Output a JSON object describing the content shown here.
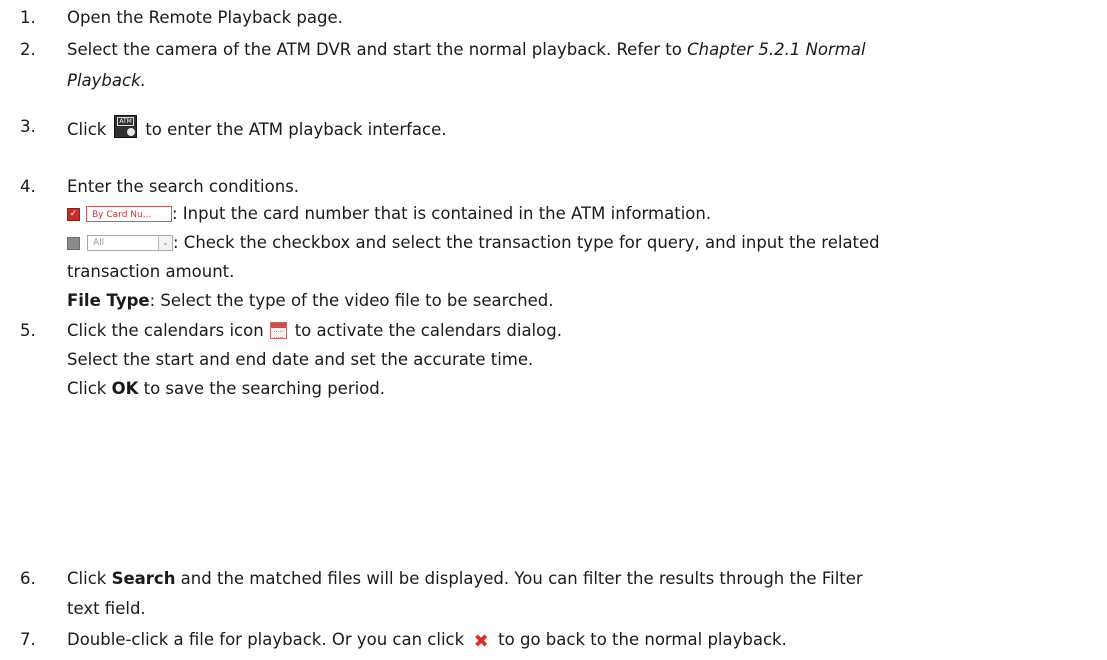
{
  "steps": [
    {
      "num": "1.",
      "text": "Open the Remote Playback page."
    },
    {
      "num": "2.",
      "line1": "Select the camera of the ATM DVR and start the normal playback. Refer to ",
      "ref1": "Chapter 5.2.1 Normal",
      "ref2": "Playback."
    },
    {
      "num": "3.",
      "pre": "Click",
      "post": "to enter the ATM playback interface."
    },
    {
      "num": "4.",
      "text": "Enter the search conditions.",
      "card_placeholder": "By Card Nu...",
      "card_desc": ": Input the card number that is contained in the ATM information.",
      "type_select_value": "All",
      "type_desc1": ": Check the checkbox and select the transaction type for query, and input the related",
      "type_desc2": "transaction amount.",
      "filetype_label": "File Type",
      "filetype_desc": ": Select the type of the video file to be searched."
    },
    {
      "num": "5.",
      "pre": "Click the calendars icon",
      "post": "to activate the calendars dialog.",
      "line2": "Select the start and end date and set the accurate time.",
      "line3_pre": "Click ",
      "line3_bold": "OK",
      "line3_post": " to save the searching period."
    },
    {
      "num": "6.",
      "pre": "Click ",
      "bold": "Search",
      "post": " and the matched files will be displayed. You can filter the results through the Filter",
      "line2": "text field."
    },
    {
      "num": "7.",
      "pre": "Double-click a file for playback. Or you can click",
      "post": "to go back to the normal playback."
    }
  ],
  "icons": [
    "atm-playback-icon",
    "checkbox-checked-icon",
    "checkbox-unchecked-icon",
    "dropdown-arrow-icon",
    "calendar-icon",
    "close-icon"
  ],
  "colors": {
    "text": "#1a1a1a",
    "accent_red": "#c62d2d"
  }
}
